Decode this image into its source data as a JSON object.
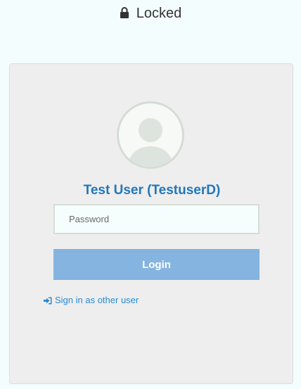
{
  "header": {
    "status_label": "Locked",
    "icon": "lock-icon"
  },
  "card": {
    "avatar_icon": "user-avatar-icon",
    "user_name": "Test User (TestuserD)",
    "password_placeholder": "Password",
    "password_value": "",
    "login_label": "Login",
    "other_user_label": "Sign in as other user",
    "other_user_icon": "sign-in-icon"
  },
  "colors": {
    "background": "#f4fdfd",
    "card_background": "#eeeeee",
    "accent": "#2377b9",
    "button": "#85b4e0",
    "link": "#2b8ad0"
  }
}
